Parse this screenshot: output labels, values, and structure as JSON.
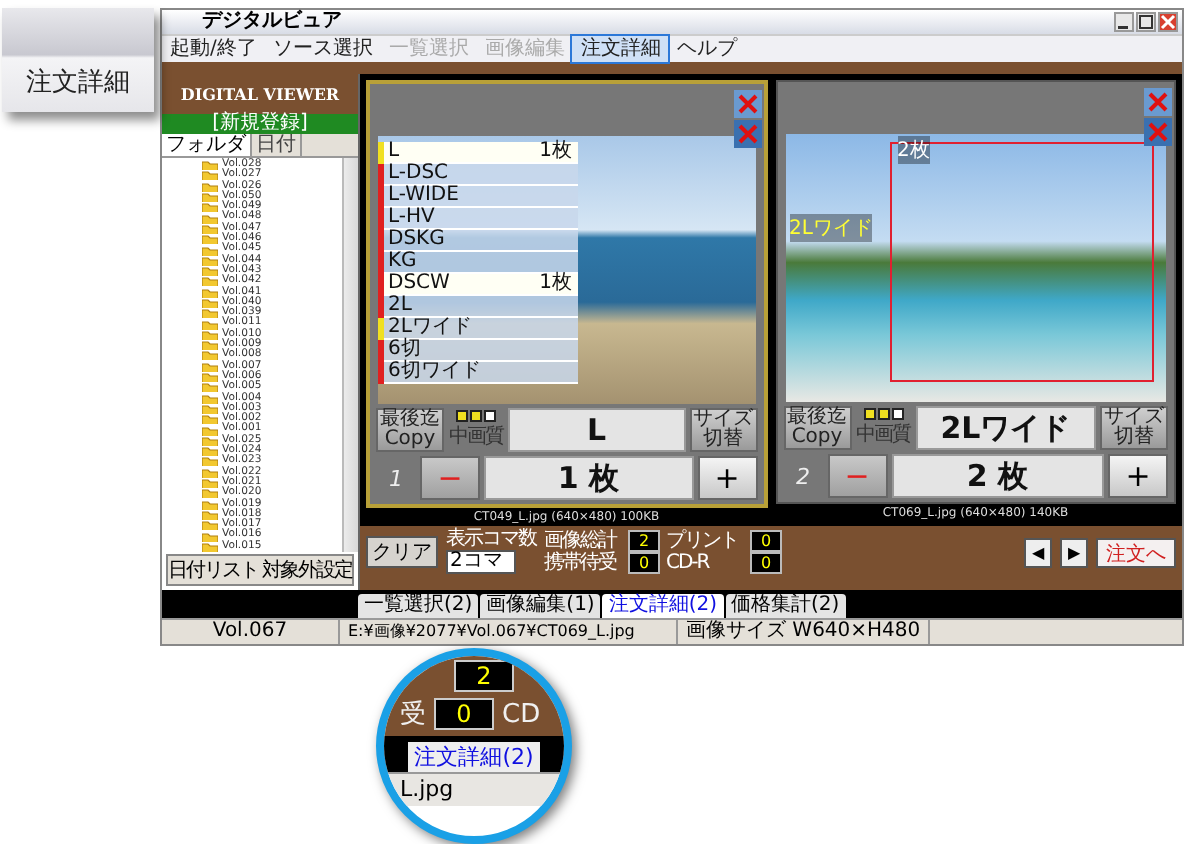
{
  "callout": {
    "label": "注文詳細"
  },
  "window": {
    "title": "デジタルビュア"
  },
  "menu": [
    {
      "label": "起動/終了",
      "selected": false,
      "disabled": false
    },
    {
      "label": "ソース選択",
      "selected": false,
      "disabled": false
    },
    {
      "label": "一覧選択",
      "selected": false,
      "disabled": true
    },
    {
      "label": "画像編集",
      "selected": false,
      "disabled": true
    },
    {
      "label": "注文詳細",
      "selected": true,
      "disabled": false
    },
    {
      "label": "ヘルプ",
      "selected": false,
      "disabled": false
    }
  ],
  "sidebar": {
    "header": "DIGITAL VIEWER",
    "banner": "[新規登録]",
    "tabs": [
      {
        "label": "フォルダ",
        "selected": true
      },
      {
        "label": "日付",
        "selected": false
      }
    ],
    "folders": [
      "Vol.028",
      "Vol.027",
      "Vol.026",
      "Vol.050",
      "Vol.049",
      "Vol.048",
      "Vol.047",
      "Vol.046",
      "Vol.045",
      "Vol.044",
      "Vol.043",
      "Vol.042",
      "Vol.041",
      "Vol.040",
      "Vol.039",
      "Vol.011",
      "Vol.010",
      "Vol.009",
      "Vol.008",
      "Vol.007",
      "Vol.006",
      "Vol.005",
      "Vol.004",
      "Vol.003",
      "Vol.002",
      "Vol.001",
      "Vol.025",
      "Vol.024",
      "Vol.023",
      "Vol.022",
      "Vol.021",
      "Vol.020",
      "Vol.019",
      "Vol.018",
      "Vol.017",
      "Vol.016",
      "Vol.015"
    ],
    "button": "日付リスト 対象外設定"
  },
  "panels": [
    {
      "index": "1",
      "selected": true,
      "kind": "list",
      "size_list": [
        {
          "label": "L",
          "count": "1枚",
          "color": "#f0e020"
        },
        {
          "label": "L-DSC",
          "color": "#e02020"
        },
        {
          "label": "L-WIDE",
          "color": "#e02020"
        },
        {
          "label": "L-HV",
          "color": "#e02020"
        },
        {
          "label": "DSKG",
          "color": "#e02020"
        },
        {
          "label": "KG",
          "color": "#e02020"
        },
        {
          "label": "DSCW",
          "count": "1枚",
          "color": "#e02020"
        },
        {
          "label": "2L",
          "color": "#e02020"
        },
        {
          "label": "2Lワイド",
          "color": "#f0e020"
        },
        {
          "label": "6切",
          "color": "#e02020"
        },
        {
          "label": "6切ワイド",
          "color": "#e02020"
        }
      ],
      "copy_button": "最後迄 Copy",
      "quality": "中画質",
      "stars": 2,
      "size": "L",
      "switch_button": "サイズ切替",
      "minus": "−",
      "quantity": "1 枚",
      "plus": "+",
      "caption": "CT049_L.jpg (640×480) 100KB"
    },
    {
      "index": "2",
      "selected": false,
      "kind": "crop",
      "overlay_count": "2枚",
      "overlay_label": "2Lワイド",
      "copy_button": "最後迄 Copy",
      "quality": "中画質",
      "stars": 2,
      "size": "2Lワイド",
      "switch_button": "サイズ切替",
      "minus": "−",
      "quantity": "2 枚",
      "plus": "+",
      "caption": "CT069_L.jpg (640×480) 140KB"
    }
  ],
  "bottom_bar": {
    "clear_button": "クリア",
    "frames_label": "表示コマ数",
    "frames_value": "2コマ",
    "counters": [
      {
        "label": "画像総計",
        "value": "2"
      },
      {
        "label": "プリント",
        "value": "0"
      },
      {
        "label": "携帯待受",
        "value": "0"
      },
      {
        "label": "CD-R",
        "value": "0"
      }
    ],
    "prev": "◀",
    "next": "▶",
    "order_button": "注文へ"
  },
  "tabs": [
    {
      "label": "一覧選択(2)",
      "selected": false
    },
    {
      "label": "画像編集(1)",
      "selected": false
    },
    {
      "label": "注文詳細(2)",
      "selected": true
    },
    {
      "label": "価格集計(2)",
      "selected": false
    }
  ],
  "status_bar": [
    "Vol.067",
    "E:¥画像¥2077¥Vol.067¥CT069_L.jpg",
    "画像サイズ W640×H480"
  ],
  "magnifier": {
    "top_value": "2",
    "label_left": "受",
    "value": "0",
    "label_right": "CD",
    "tab": "注文詳細(2)",
    "file": "L.jpg"
  }
}
